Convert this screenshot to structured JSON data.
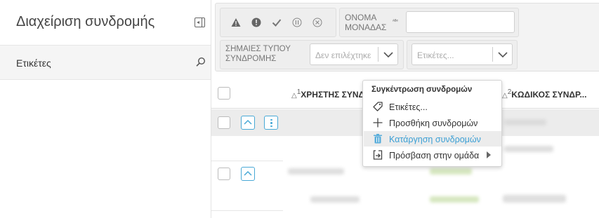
{
  "sidebar": {
    "title": "Διαχείριση συνδρομής",
    "tags_label": "Ετικέτες"
  },
  "filters": {
    "status_icons": [
      "warning-icon",
      "alert-icon",
      "check-icon",
      "pause-icon",
      "cancel-icon"
    ],
    "unit_name_label": "ΟΝΟΜΑ ΜΟΝΑΔΑΣ",
    "abc_badge": "ᴬᴮᶜ",
    "unit_name_value": "",
    "subscription_flags_label": "ΣΗΜΑΙΕΣ ΤΥΠΟΥ ΣΥΝΔΡΟΜΗΣ",
    "subscription_flags_placeholder": "Δεν επιλέχτηκε",
    "tags_placeholder": "Ετικέτες..."
  },
  "table": {
    "columns": [
      {
        "sort_index": "1",
        "label": "ΧΡΗΣΤΗΣ ΣΥΝΔ..."
      },
      {
        "sort_index": "2",
        "label": "ΚΩΔΙΚΟΣ ΣΥΝΔΡ..."
      }
    ]
  },
  "context_menu": {
    "header": "Συγκέντρωση συνδρομών",
    "items": [
      {
        "label": "Ετικέτες...",
        "icon": "tag-icon",
        "active": false
      },
      {
        "label": "Προσθήκη συνδρομών",
        "icon": "plus-icon",
        "active": false
      },
      {
        "label": "Κατάργηση συνδρομών",
        "icon": "trash-icon",
        "active": true
      },
      {
        "label": "Πρόσβαση στην ομάδα",
        "icon": "share-icon",
        "active": false,
        "submenu": true
      }
    ]
  },
  "colors": {
    "accent": "#3a9fd5",
    "button_border": "#49a9d6"
  }
}
